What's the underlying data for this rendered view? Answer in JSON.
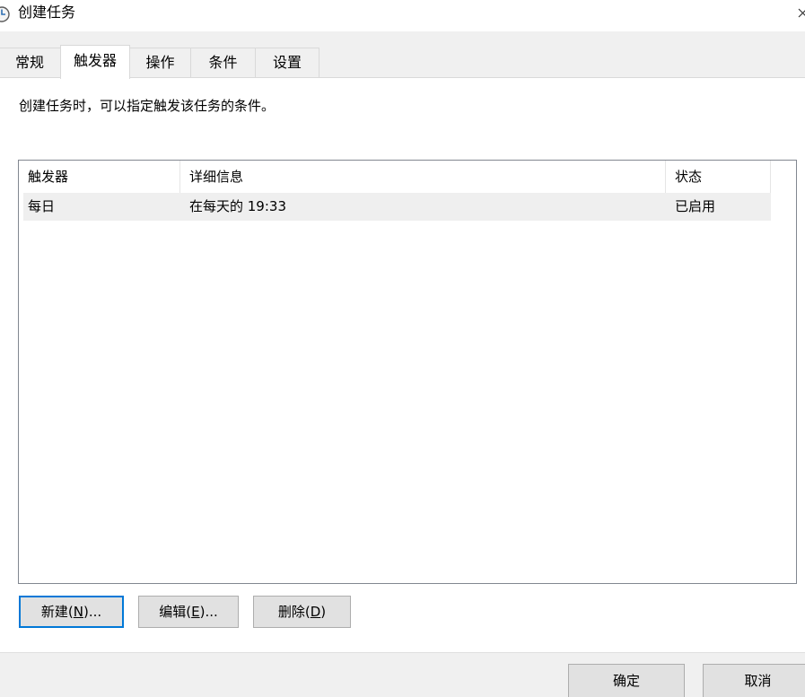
{
  "window": {
    "title": "创建任务",
    "icon": "clock-icon"
  },
  "tabs": [
    {
      "label": "常规"
    },
    {
      "label": "触发器"
    },
    {
      "label": "操作"
    },
    {
      "label": "条件"
    },
    {
      "label": "设置"
    }
  ],
  "active_tab": "触发器",
  "triggers_panel": {
    "description": "创建任务时，可以指定触发该任务的条件。",
    "columns": [
      "触发器",
      "详细信息",
      "状态"
    ],
    "rows": [
      {
        "trigger": "每日",
        "details": "在每天的 19:33",
        "status": "已启用"
      }
    ],
    "buttons": {
      "new": {
        "text": "新建(",
        "key": "N",
        "suffix": ")..."
      },
      "edit": {
        "text": "编辑(",
        "key": "E",
        "suffix": ")..."
      },
      "delete": {
        "text": "删除(",
        "key": "D",
        "suffix": ")"
      }
    }
  },
  "footer": {
    "ok_label": "确定",
    "cancel_label": "取消"
  },
  "colors": {
    "focus_border": "#0078d7",
    "row_background": "#efefef",
    "panel_background": "#ffffff",
    "chrome_background": "#f0f0f0"
  }
}
